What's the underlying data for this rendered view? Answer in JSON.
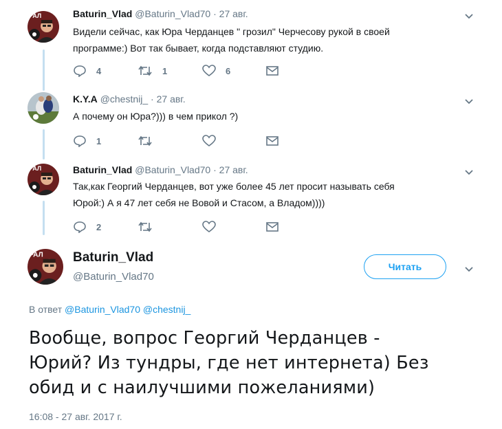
{
  "colors": {
    "accent": "#1da1f2",
    "muted": "#657786",
    "thread_line": "#c4dff0",
    "text": "#14171a"
  },
  "tweets": [
    {
      "name": "Baturin_Vlad",
      "handle": "@Baturin_Vlad70",
      "separator": "·",
      "date": "27 авг.",
      "lines": [
        "Видели сейчас, как Юра Черданцев \" грозил\" Черчесову рукой в своей",
        "программе:) Вот так бывает, когда подставляют студию."
      ],
      "reply_count": "4",
      "retweet_count": "1",
      "like_count": "6"
    },
    {
      "name": "K.Y.A",
      "handle": "@chestnij_",
      "separator": "·",
      "date": "27 авг.",
      "lines": [
        "А почему он Юра?))) в чем прикол ?)"
      ],
      "reply_count": "1",
      "retweet_count": "",
      "like_count": ""
    },
    {
      "name": "Baturin_Vlad",
      "handle": "@Baturin_Vlad70",
      "separator": "·",
      "date": "27 авг.",
      "lines": [
        "Так,как Георгий Черданцев, вот уже более 45 лет просит называть себя",
        "Юрой:) А я 47 лет себя не Вовой и Стасом, а Владом))))"
      ],
      "reply_count": "2",
      "retweet_count": "",
      "like_count": ""
    }
  ],
  "main": {
    "name": "Baturin_Vlad",
    "handle": "@Baturin_Vlad70",
    "follow_label": "Читать",
    "reply_prefix": "В ответ",
    "reply_user_1": "@Baturin_Vlad70",
    "reply_user_2": "@chestnij_",
    "text_lines": [
      "Вообще, вопрос Георгий Черданцев -",
      "Юрий? Из тундры, где нет интернета) Без",
      "обид и с наилучшими пожеланиями)"
    ],
    "timestamp": "16:08 - 27 авг. 2017 г."
  }
}
